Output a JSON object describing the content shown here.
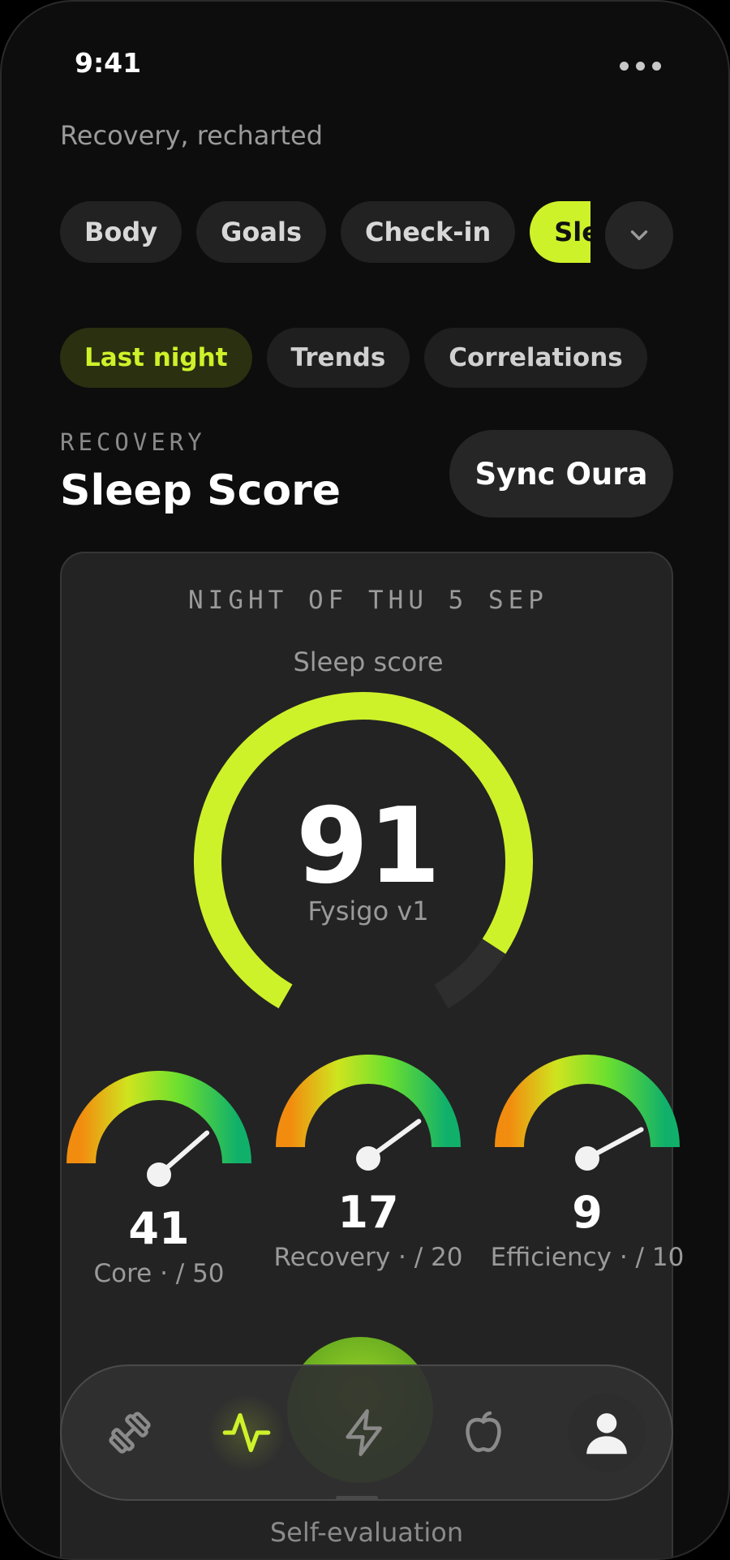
{
  "status_bar": {
    "time": "9:41"
  },
  "header": {
    "subtitle": "Recovery, recharted"
  },
  "chips": [
    {
      "label": "Body",
      "active": false
    },
    {
      "label": "Goals",
      "active": false
    },
    {
      "label": "Check-in",
      "active": false
    },
    {
      "label": "Sleep",
      "active": true
    }
  ],
  "segments": [
    {
      "label": "Last night",
      "active": true
    },
    {
      "label": "Trends",
      "active": false
    },
    {
      "label": "Correlations",
      "active": false
    }
  ],
  "section": {
    "eyebrow": "RECOVERY",
    "title": "Sleep Score",
    "sync_label": "Sync Oura"
  },
  "card": {
    "date": "NIGHT OF THU 5 SEP",
    "score_label": "Sleep score",
    "score": 91,
    "score_max": 100,
    "score_caption": "Fysigo v1",
    "subscores": [
      {
        "value": 41,
        "max": 50,
        "label": "Core · / 50"
      },
      {
        "value": 17,
        "max": 20,
        "label": "Recovery · / 20"
      },
      {
        "value": 9,
        "max": 10,
        "label": "Efficiency · / 10"
      }
    ],
    "footer_label": "Self-evaluation"
  },
  "colors": {
    "accent": "#cdf22a",
    "background": "#0d0d0d",
    "card": "#232323"
  },
  "tabbar": [
    {
      "icon": "dumbbell-icon",
      "active": false
    },
    {
      "icon": "activity-pulse-icon",
      "active": true
    },
    {
      "icon": "lightning-icon",
      "active": false
    },
    {
      "icon": "apple-icon",
      "active": false
    },
    {
      "icon": "profile-avatar-icon",
      "active": false
    }
  ]
}
